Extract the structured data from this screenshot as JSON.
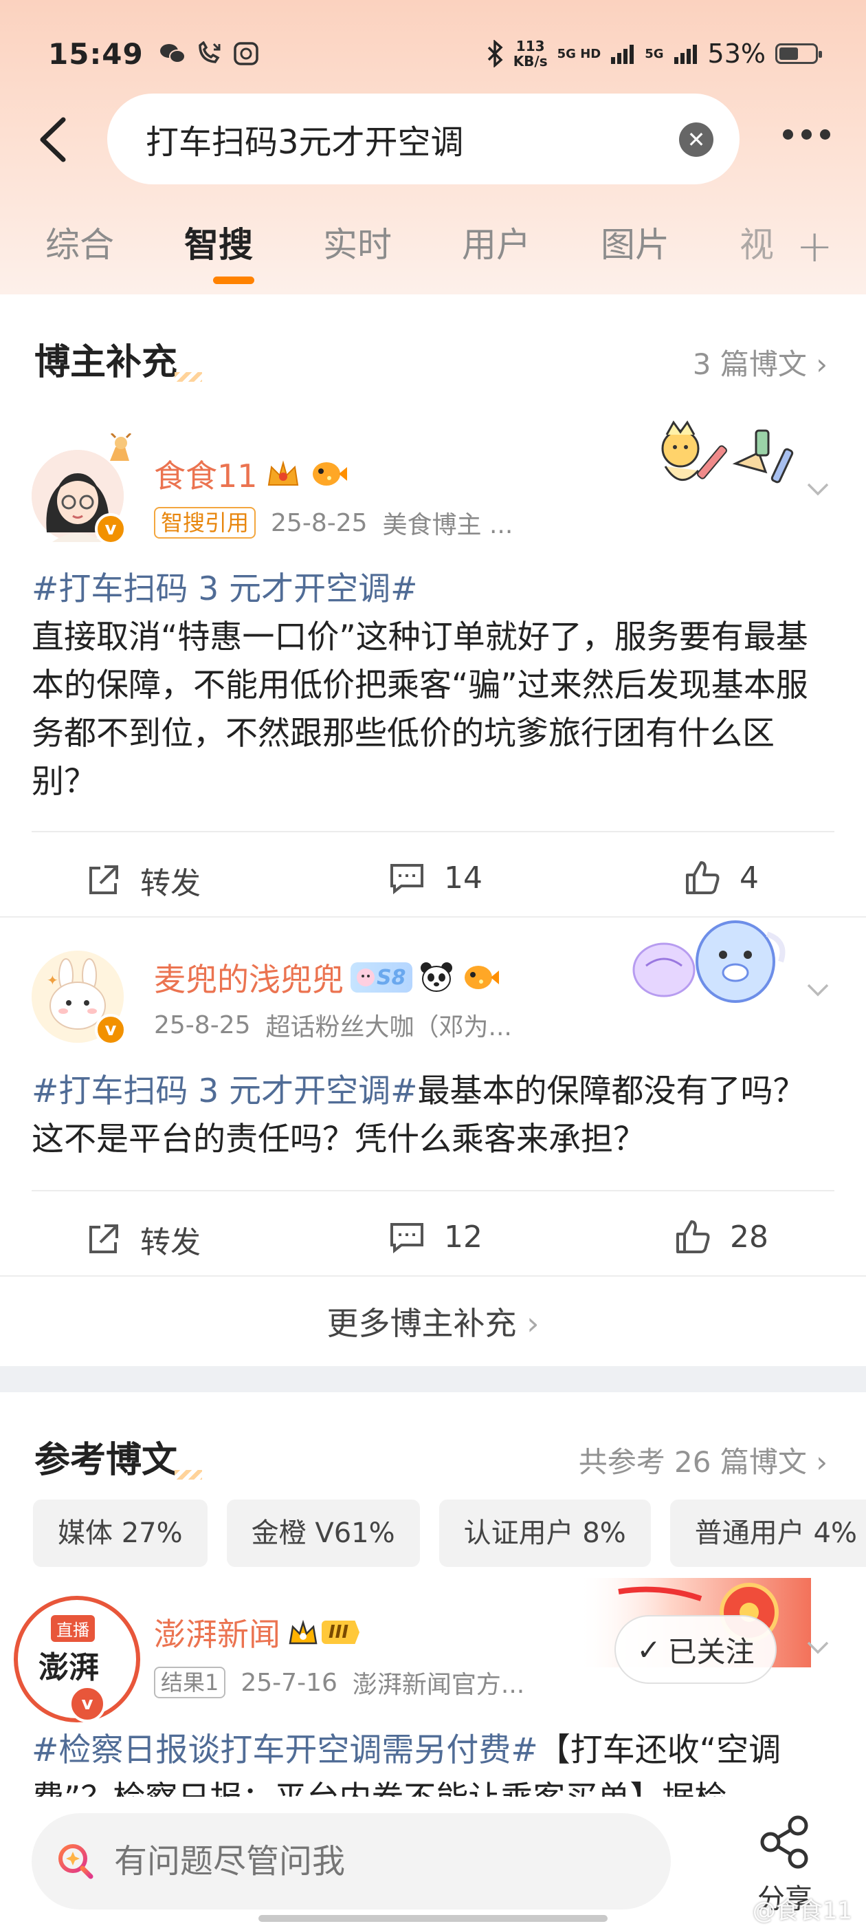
{
  "status_bar": {
    "time": "15:49",
    "speed_value": "113",
    "speed_unit": "KB/s",
    "net1": "5G HD",
    "net2": "5G",
    "battery": "53%",
    "battery_level": 0.53
  },
  "search": {
    "query": "打车扫码3元才开空调"
  },
  "tabs": [
    {
      "label": "综合",
      "active": false
    },
    {
      "label": "智搜",
      "active": true
    },
    {
      "label": "实时",
      "active": false
    },
    {
      "label": "用户",
      "active": false
    },
    {
      "label": "图片",
      "active": false
    },
    {
      "label": "视",
      "active": false
    }
  ],
  "plus": "+",
  "blogger_section": {
    "title": "博主补充",
    "link": "3 篇博文",
    "posts": [
      {
        "username": "食食11",
        "tag": "智搜引用",
        "date": "25-8-25",
        "source": "美食博主 ...",
        "topic": "#打车扫码 3 元才开空调#",
        "text": "直接取消“特惠一口价”这种订单就好了，服务要有最基本的保障，不能用低价把乘客“骗”过来然后发现基本服务都不到位，不然跟那些低价的坑爹旅行团有什么区别？",
        "repost": "转发",
        "comments": "14",
        "likes": "4"
      },
      {
        "username": "麦兜的浅兜兜",
        "badge": "S8",
        "date": "25-8-25",
        "source": "超话粉丝大咖（邓为...",
        "topic": "#打车扫码 3 元才开空调#",
        "text": "最基本的保障都没有了吗？这不是平台的责任吗？凭什么乘客来承担？",
        "repost": "转发",
        "comments": "12",
        "likes": "28"
      }
    ],
    "more": "更多博主补充"
  },
  "reference_section": {
    "title": "参考博文",
    "link": "共参考 26 篇博文",
    "chips": [
      "媒体 27%",
      "金橙 V61%",
      "认证用户 8%",
      "普通用户 4%"
    ],
    "post": {
      "avatar_top": "直播",
      "avatar_text": "澎湃",
      "username": "澎湃新闻",
      "level": "III",
      "tag": "结果1",
      "date": "25-7-16",
      "source": "澎湃新闻官方...",
      "follow": "已关注",
      "topic": "#检察日报谈打车开空调需另付费#",
      "text": "【打车还收“空调费”？检察日报：平台内卷不能让乘客买单】据检"
    }
  },
  "bottom_bar": {
    "ask_placeholder": "有问题尽管问我",
    "share": "分享",
    "watermark": "@食食11"
  },
  "colors": {
    "accent": "#ff8200",
    "username": "#eb7350",
    "topic": "#506c96"
  }
}
